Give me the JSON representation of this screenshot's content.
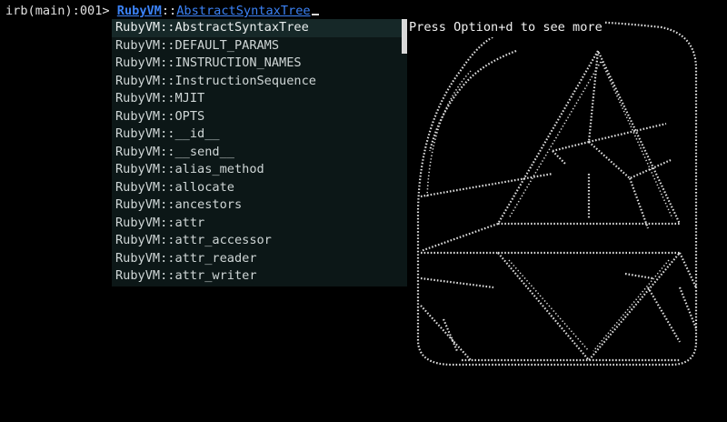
{
  "terminal": {
    "prompt": "irb(main):001> ",
    "input_namespace": "RubyVM",
    "input_separator": "::",
    "input_constant": "AbstractSyntaxTree"
  },
  "completion": {
    "selected_index": 0,
    "items": [
      "RubyVM::AbstractSyntaxTree",
      "RubyVM::DEFAULT_PARAMS",
      "RubyVM::INSTRUCTION_NAMES",
      "RubyVM::InstructionSequence",
      "RubyVM::MJIT",
      "RubyVM::OPTS",
      "RubyVM::__id__",
      "RubyVM::__send__",
      "RubyVM::alias_method",
      "RubyVM::allocate",
      "RubyVM::ancestors",
      "RubyVM::attr",
      "RubyVM::attr_accessor",
      "RubyVM::attr_reader",
      "RubyVM::attr_writer"
    ]
  },
  "doc_dialog": {
    "hint": "Press Option+d to see more"
  },
  "colors": {
    "background": "#000000",
    "input_highlight": "#3b82f6",
    "dialog_background": "#0c1717",
    "dialog_selected": "#162828",
    "ascii_art": "#dcdcdc"
  },
  "icons": {
    "logo": "ruby-logo-ascii-art"
  }
}
